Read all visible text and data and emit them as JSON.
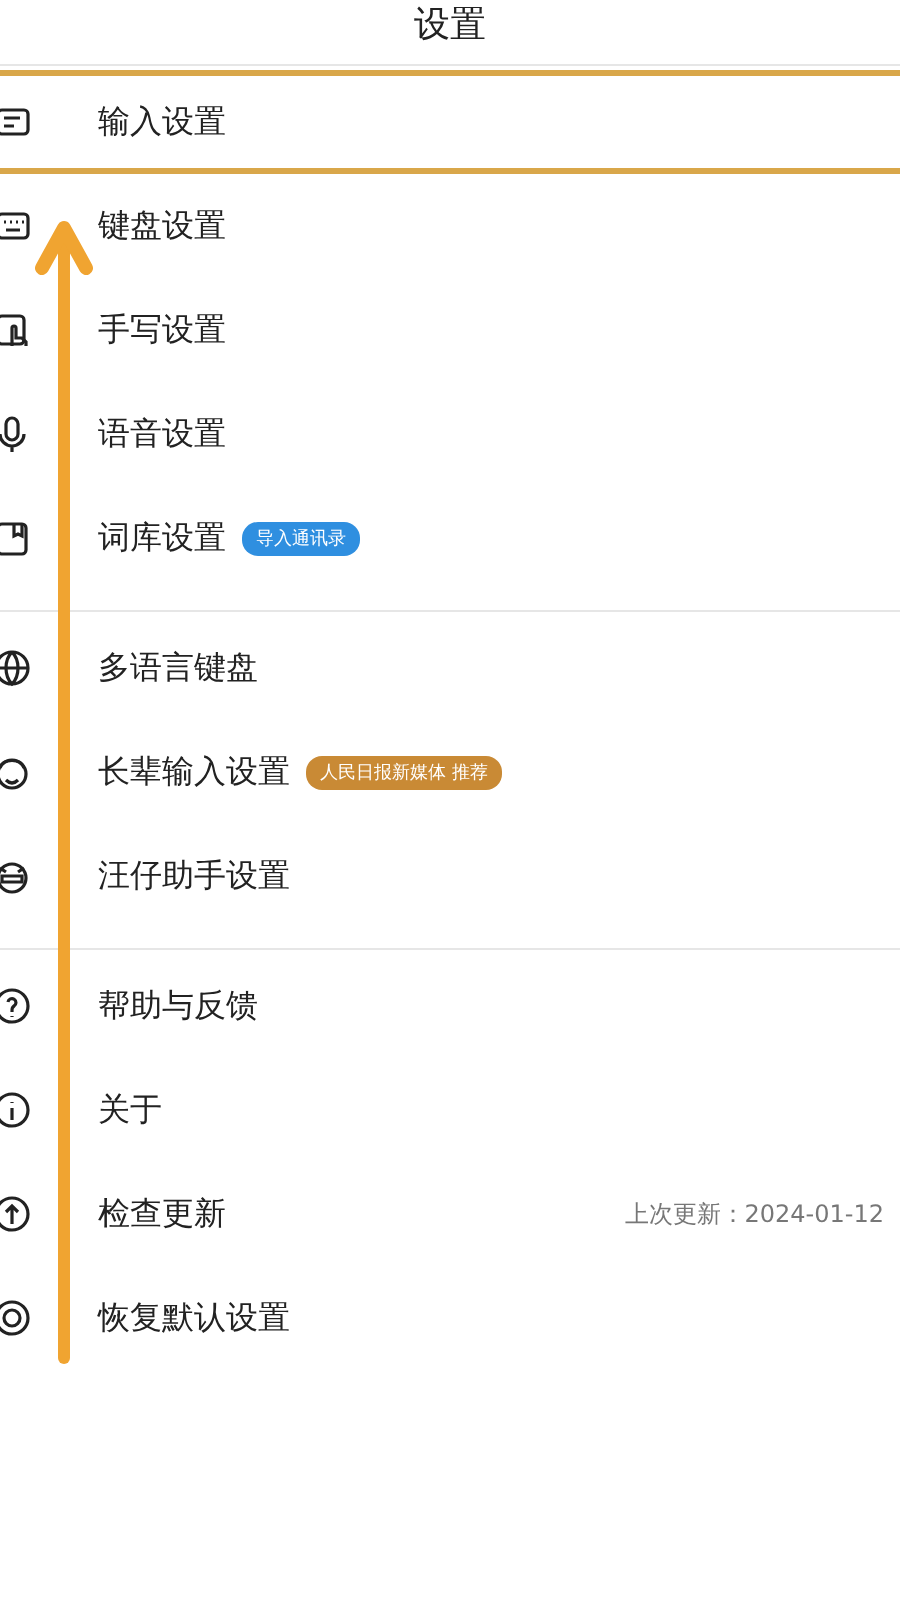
{
  "title": "设置",
  "sections": [
    {
      "items": [
        {
          "label": "输入设置",
          "highlighted": true
        },
        {
          "label": "键盘设置",
          "highlighted": false
        },
        {
          "label": "手写设置",
          "highlighted": false
        },
        {
          "label": "语音设置",
          "highlighted": false
        },
        {
          "label": "词库设置",
          "highlighted": false,
          "badge": {
            "text": "导入通讯录",
            "color": "#2f8fe0"
          }
        }
      ]
    },
    {
      "items": [
        {
          "label": "多语言键盘",
          "highlighted": false
        },
        {
          "label": "长辈输入设置",
          "highlighted": false,
          "badge": {
            "text": "人民日报新媒体 推荐",
            "color": "#c98a35"
          }
        },
        {
          "label": "汪仔助手设置",
          "highlighted": false
        }
      ]
    },
    {
      "items": [
        {
          "label": "帮助与反馈",
          "highlighted": false
        },
        {
          "label": "关于",
          "highlighted": false
        },
        {
          "label": "检查更新",
          "highlighted": false,
          "detail": "上次更新：2024-01-12"
        },
        {
          "label": "恢复默认设置",
          "highlighted": false
        }
      ]
    }
  ],
  "annotation": {
    "kind": "arrow"
  }
}
